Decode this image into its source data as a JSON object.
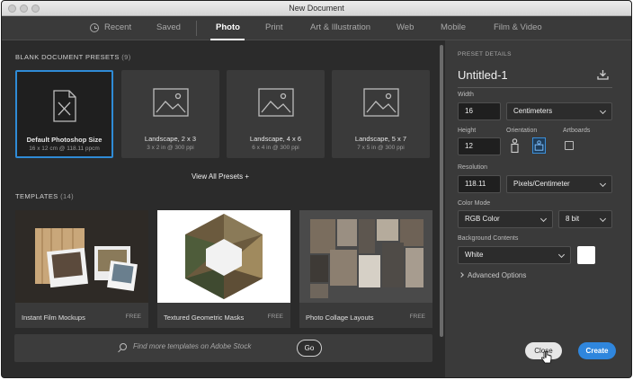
{
  "window": {
    "title": "New Document"
  },
  "tabs": [
    {
      "label": "Recent"
    },
    {
      "label": "Saved"
    },
    {
      "label": "Photo"
    },
    {
      "label": "Print"
    },
    {
      "label": "Art & Illustration"
    },
    {
      "label": "Web"
    },
    {
      "label": "Mobile"
    },
    {
      "label": "Film & Video"
    }
  ],
  "active_tab": "Photo",
  "blank_presets": {
    "heading": "BLANK DOCUMENT PRESETS",
    "count": "(9)",
    "items": [
      {
        "name": "Default Photoshop Size",
        "dims": "16 x 12 cm @ 118.11 ppcm",
        "icon": "blank-document-icon",
        "selected": true
      },
      {
        "name": "Landscape, 2 x 3",
        "dims": "3 x 2 in @ 300 ppi",
        "icon": "image-icon"
      },
      {
        "name": "Landscape, 4 x 6",
        "dims": "6 x 4 in @ 300 ppi",
        "icon": "image-icon"
      },
      {
        "name": "Landscape, 5 x 7",
        "dims": "7 x 5 in @ 300 ppi",
        "icon": "image-icon"
      }
    ],
    "view_all": "View All Presets +"
  },
  "templates": {
    "heading": "TEMPLATES",
    "count": "(14)",
    "items": [
      {
        "name": "Instant Film Mockups",
        "badge": "FREE"
      },
      {
        "name": "Textured Geometric Masks",
        "badge": "FREE"
      },
      {
        "name": "Photo Collage Layouts",
        "badge": "FREE"
      }
    ]
  },
  "stock": {
    "placeholder": "Find more templates on Adobe Stock",
    "go_label": "Go"
  },
  "details": {
    "heading": "PRESET DETAILS",
    "doc_name": "Untitled-1",
    "width_label": "Width",
    "width_value": "16",
    "width_unit": "Centimeters",
    "height_label": "Height",
    "height_value": "12",
    "orientation_label": "Orientation",
    "orientation": "landscape",
    "artboards_label": "Artboards",
    "artboards_checked": false,
    "resolution_label": "Resolution",
    "resolution_value": "118.11",
    "resolution_unit": "Pixels/Centimeter",
    "color_mode_label": "Color Mode",
    "color_mode": "RGB Color",
    "bit_depth": "8 bit",
    "background_label": "Background Contents",
    "background": "White",
    "background_swatch": "#ffffff",
    "advanced": "Advanced Options"
  },
  "buttons": {
    "close": "Close",
    "create": "Create"
  },
  "colors": {
    "accent": "#2f86dd",
    "panel": "#3a3a3a",
    "bg": "#2b2b2b"
  }
}
